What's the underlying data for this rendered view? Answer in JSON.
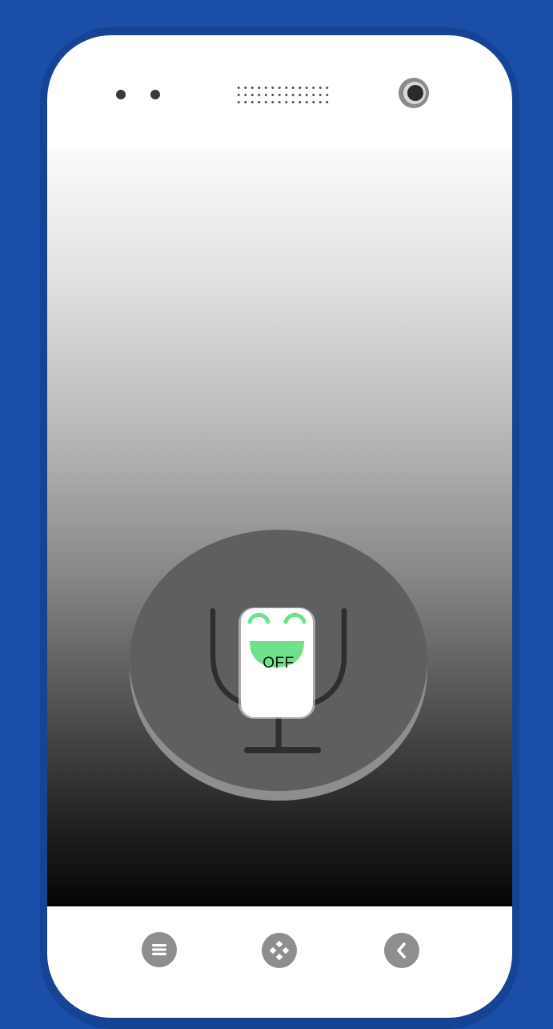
{
  "mic": {
    "state_label": "OFF"
  },
  "colors": {
    "background": "#1a4ea8",
    "frame": "#164393",
    "face_accent": "#6fe08c",
    "button_gray": "#8e8e8e"
  },
  "icons": {
    "front_camera": "camera-icon",
    "microphone": "microphone-icon",
    "mascot": "smiley-face-icon",
    "menu": "menu-icon",
    "gamepad": "gamepad-icon",
    "back": "back-arrow-icon"
  }
}
